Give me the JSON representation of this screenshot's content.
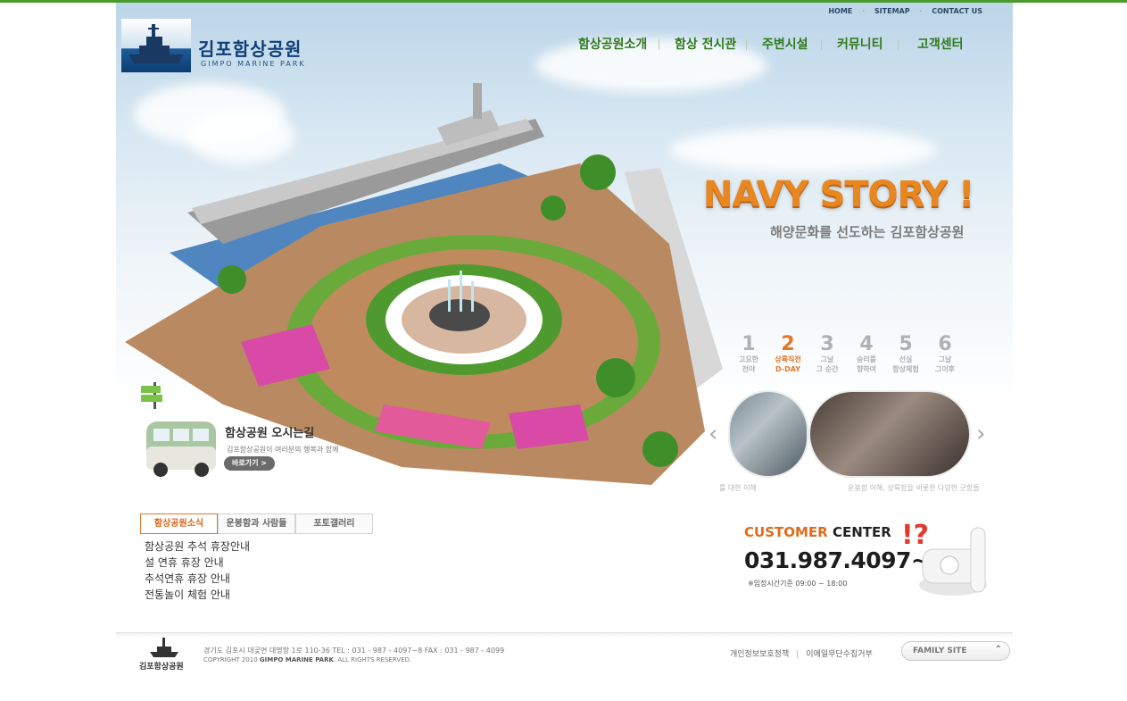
{
  "header": {
    "logo_title": "김포함상공원",
    "logo_sub": "GIMPO MARINE PARK",
    "util_links": [
      "HOME",
      "SITEMAP",
      "CONTACT US"
    ],
    "nav": [
      "함상공원소개",
      "함상 전시관",
      "주변시설",
      "커뮤니티",
      "고객센터"
    ]
  },
  "hero": {
    "headline": "NAVY STORY !",
    "subline": "해양문화를 선도하는 김포함상공원",
    "steps": [
      {
        "num": "1",
        "label": "고요한\n전야"
      },
      {
        "num": "2",
        "label": "상륙직전\nD-DAY"
      },
      {
        "num": "3",
        "label": "그날\n그 순간"
      },
      {
        "num": "4",
        "label": "승리를\n향하여"
      },
      {
        "num": "5",
        "label": "선실\n함상체험"
      },
      {
        "num": "6",
        "label": "그날\n그이후"
      }
    ],
    "thumb_captions": [
      "를 대한 이해",
      "운봉함 이해, 상륙함을 비롯한 다양한 군함들"
    ],
    "visit": {
      "title": "함상공원 오시는길",
      "desc": "김포함상공원이 여러분의 행복과 함께",
      "button": "바로가기 >"
    }
  },
  "news": {
    "tabs": [
      "함상공원소식",
      "운봉함과 사람들",
      "포토갤러리"
    ],
    "items": [
      "함상공원 추석 휴장안내",
      "설 연휴 휴장 안내",
      "추석연휴 휴장 안내",
      "전통놀이 체험 안내"
    ]
  },
  "customer": {
    "title_orange": "CUSTOMER",
    "title_dark": "CENTER",
    "phone": "031.987.4097~8",
    "hours": "※입장시간기준 09:00 ~ 18:00"
  },
  "footer": {
    "logo_text": "김포함상공원",
    "address": "경기도 김포시 대곶면 대명항 1로 110-36  TEL : 031 - 987 - 4097~8     FAX : 031 - 987 - 4099",
    "copyright_pre": "COPYRIGHT 2010 ",
    "copyright_bold": "GIMPO MARINE PARK",
    "copyright_post": ". ALL RIGHTS RESERVED.",
    "link_privacy": "개인정보보호정책",
    "link_email": "이메일무단수집거부",
    "family_site": "FAMILY SITE"
  }
}
